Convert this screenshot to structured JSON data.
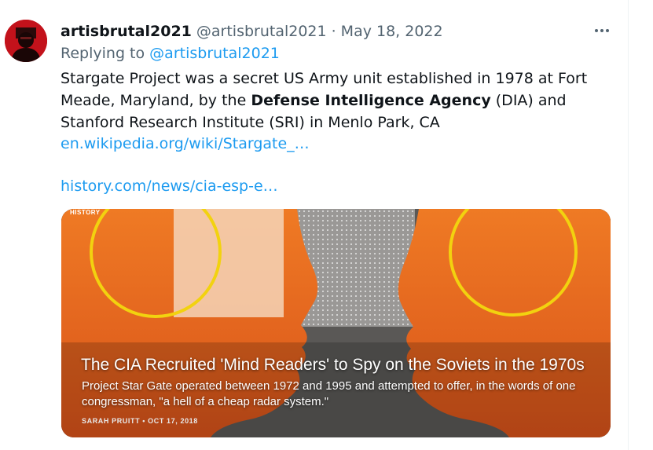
{
  "tweet": {
    "author_name": "artisbrutal2021",
    "author_handle": "@artisbrutal2021",
    "separator": "·",
    "date": "May 18, 2022",
    "reply_prefix": "Replying to",
    "reply_handle": "@artisbrutal2021",
    "text_part1": "Stargate Project was a secret US Army unit established in 1978 at Fort Meade, Maryland, by the ",
    "text_bold": "Defense Intelligence Agency",
    "text_part2": " (DIA) and Stanford Research Institute (SRI) in Menlo Park, CA",
    "link1": "en.wikipedia.org/wiki/Stargate_…",
    "link2": "history.com/news/cia-esp-e…"
  },
  "card": {
    "logo": "HISTORY",
    "headline": "The CIA Recruited 'Mind Readers' to Spy on the Soviets in the 1970s",
    "description": "Project Star Gate operated between 1972 and 1995 and attempted to offer, in the words of one congressman, \"a hell of a cheap radar system.\"",
    "byline": "SARAH PRUITT • OCT 17, 2018"
  },
  "icons": {
    "more": "more-horizontal-icon",
    "avatar": "avatar-image"
  },
  "colors": {
    "link": "#1d9bf0",
    "muted": "#536471",
    "text": "#0f1419",
    "card_orange": "#e8641e",
    "card_yellow": "#f2d20f"
  }
}
